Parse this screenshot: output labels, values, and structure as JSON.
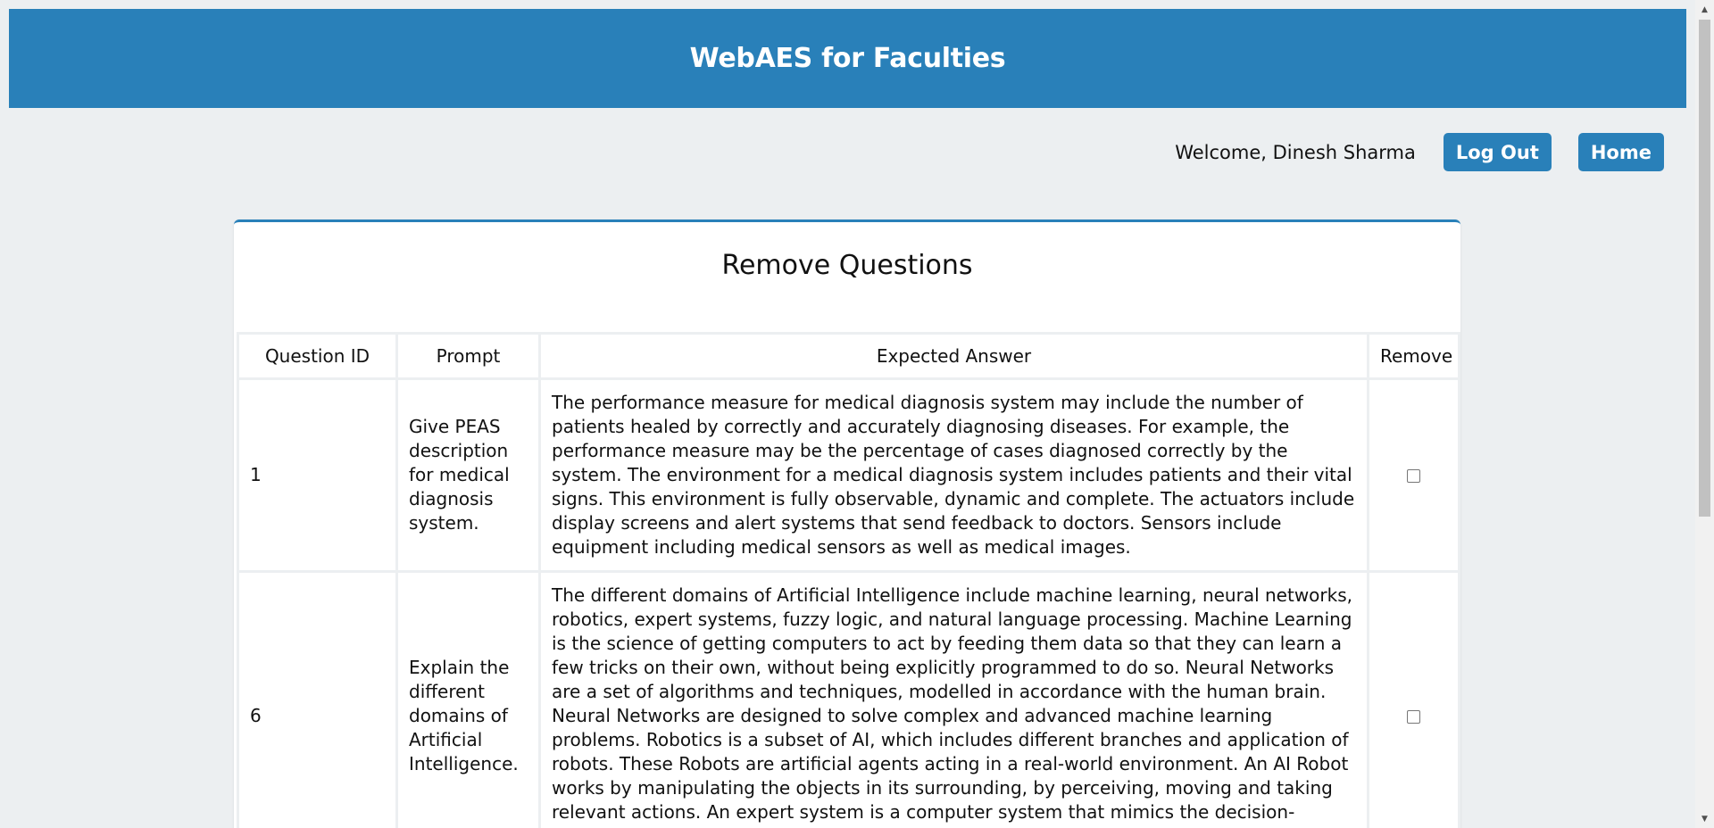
{
  "header": {
    "title": "WebAES for Faculties"
  },
  "topbar": {
    "welcome": "Welcome, Dinesh Sharma",
    "logout_label": "Log Out",
    "home_label": "Home"
  },
  "card": {
    "title": "Remove Questions",
    "columns": [
      "Question ID",
      "Prompt",
      "Expected Answer",
      "Remove"
    ],
    "rows": [
      {
        "id": "1",
        "prompt": "Give PEAS description for medical diagnosis system.",
        "answer": "The performance measure for medical diagnosis system may include the number of patients healed by correctly and accurately diagnosing diseases. For example, the performance measure may be the percentage of cases diagnosed correctly by the system. The environment for a medical diagnosis system includes patients and their vital signs. This environment is fully observable, dynamic and complete. The actuators include display screens and alert systems that send feedback to doctors. Sensors include equipment including medical sensors as well as medical images.",
        "remove": false
      },
      {
        "id": "6",
        "prompt": "Explain the different domains of Artificial Intelligence.",
        "answer": "The different domains of Artificial Intelligence include machine learning, neural networks, robotics, expert systems, fuzzy logic, and natural language processing. Machine Learning is the science of getting computers to act by feeding them data so that they can learn a few tricks on their own, without being explicitly programmed to do so. Neural Networks are a set of algorithms and techniques, modelled in accordance with the human brain. Neural Networks are designed to solve complex and advanced machine learning problems. Robotics is a subset of AI, which includes different branches and application of robots. These Robots are artificial agents acting in a real-world environment. An AI Robot works by manipulating the objects in its surrounding, by perceiving, moving and taking relevant actions. An expert system is a computer system that mimics the decision-making ability of a human. It is a computer program that uses",
        "remove": false
      }
    ]
  }
}
